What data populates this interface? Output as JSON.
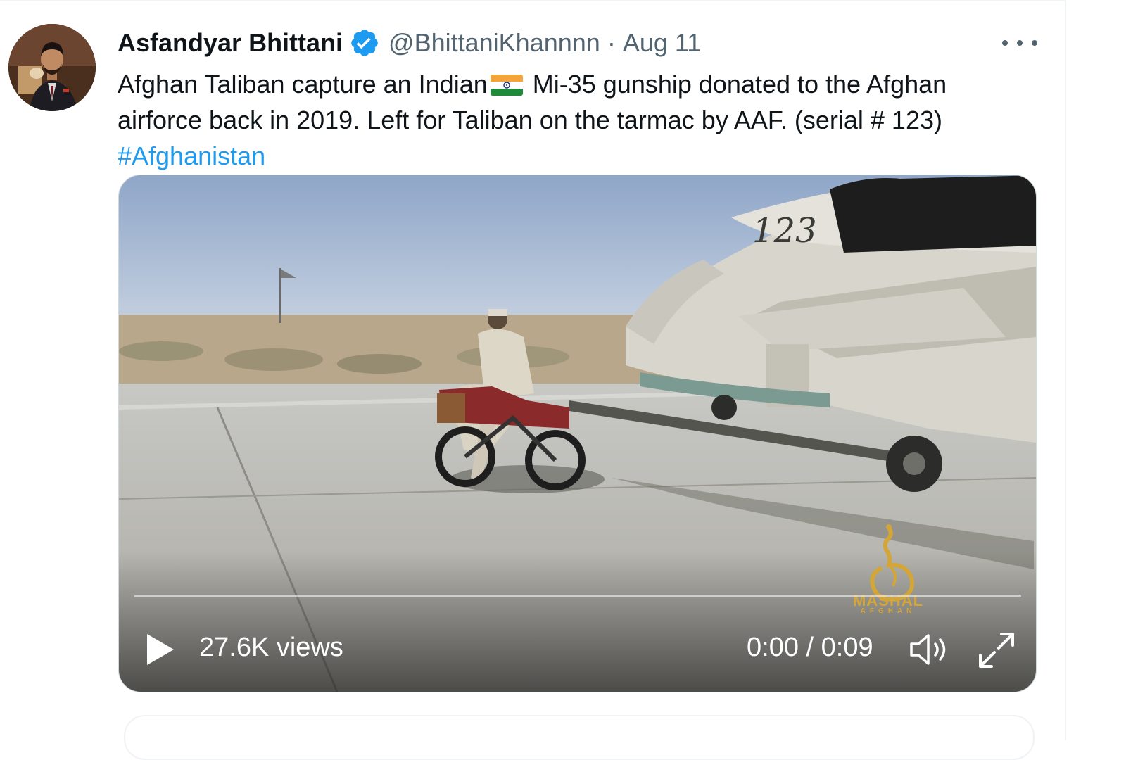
{
  "tweet": {
    "author_name": "Asfandyar Bhittani",
    "verified": true,
    "handle": "@BhittaniKhannnn",
    "separator": "·",
    "date": "Aug 11",
    "text_line1_before_flag": "Afghan Taliban capture an Indian",
    "flag_emoji": "india-flag-icon",
    "text_line1_after_flag": " Mi-35 gunship donated to the Afghan",
    "text_line2": "airforce back in 2019. Left for Taliban on the tarmac by AAF. (serial # 123)",
    "hashtag": "#Afghanistan"
  },
  "video": {
    "views": "27.6K views",
    "time": "0:00 / 0:09",
    "progress": 0,
    "helicopter_serial": "123",
    "watermark_main": "MASHAL",
    "watermark_sub": "AFGHAN"
  },
  "colors": {
    "accent": "#1d9bf0",
    "text": "#0f1419",
    "secondary": "#536471",
    "verified": "#1d9bf0"
  }
}
